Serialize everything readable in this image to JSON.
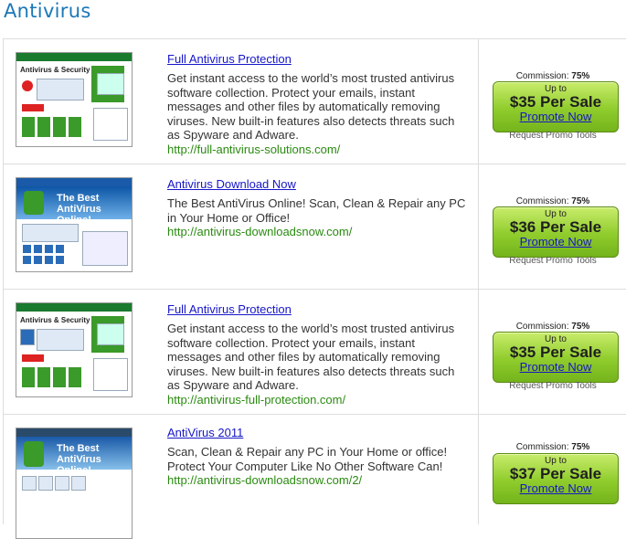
{
  "page": {
    "title": "Antivirus"
  },
  "products": [
    {
      "title": "Full Antivirus Protection",
      "description": "Get instant access to the world’s most trusted antivirus software collection. Protect your emails, instant messages and other files by automatically removing viruses. New built-in features also detects threats such as Spyware and Adware.",
      "url": "http://full-antivirus-solutions.com/",
      "commission_label": "Commission:",
      "commission_value": "75%",
      "upto": "Up to",
      "price": "$35 Per Sale",
      "promote": "Promote Now",
      "request": "Request Promo Tools",
      "thumb": {
        "heading": "Antivirus & Security",
        "style": "green"
      }
    },
    {
      "title": "Antivirus Download Now",
      "description": "The Best AntiVirus Online! Scan, Clean & Repair any PC in Your Home or Office!",
      "url": "http://antivirus-downloadsnow.com/",
      "commission_label": "Commission:",
      "commission_value": "75%",
      "upto": "Up to",
      "price": "$36 Per Sale",
      "promote": "Promote Now",
      "request": "Request Promo Tools",
      "thumb": {
        "heading": "The Best AntiVirus Online!",
        "style": "blue"
      }
    },
    {
      "title": "Full Antivirus Protection",
      "description": "Get instant access to the world’s most trusted antivirus software collection. Protect your emails, instant messages and other files by automatically removing viruses. New built-in features also detects threats such as Spyware and Adware.",
      "url": "http://antivirus-full-protection.com/",
      "commission_label": "Commission:",
      "commission_value": "75%",
      "upto": "Up to",
      "price": "$35 Per Sale",
      "promote": "Promote Now",
      "request": "Request Promo Tools",
      "thumb": {
        "heading": "Antivirus & Security",
        "style": "green"
      }
    },
    {
      "title": "AntiVirus 2011",
      "description": "Scan, Clean & Repair any PC in Your Home or office! Protect Your Computer Like No Other Software Can!",
      "url": "http://antivirus-downloadsnow.com/2/",
      "commission_label": "Commission:",
      "commission_value": "75%",
      "upto": "Up to",
      "price": "$37 Per Sale",
      "promote": "Promote Now",
      "request": "",
      "thumb": {
        "heading": "The Best AntiVirus Online!",
        "style": "blue"
      }
    }
  ],
  "colors": {
    "title_blue": "#1b78b8",
    "link": "#1616c8",
    "url_green": "#2a8a10",
    "button_green": "#8fcc2c"
  }
}
